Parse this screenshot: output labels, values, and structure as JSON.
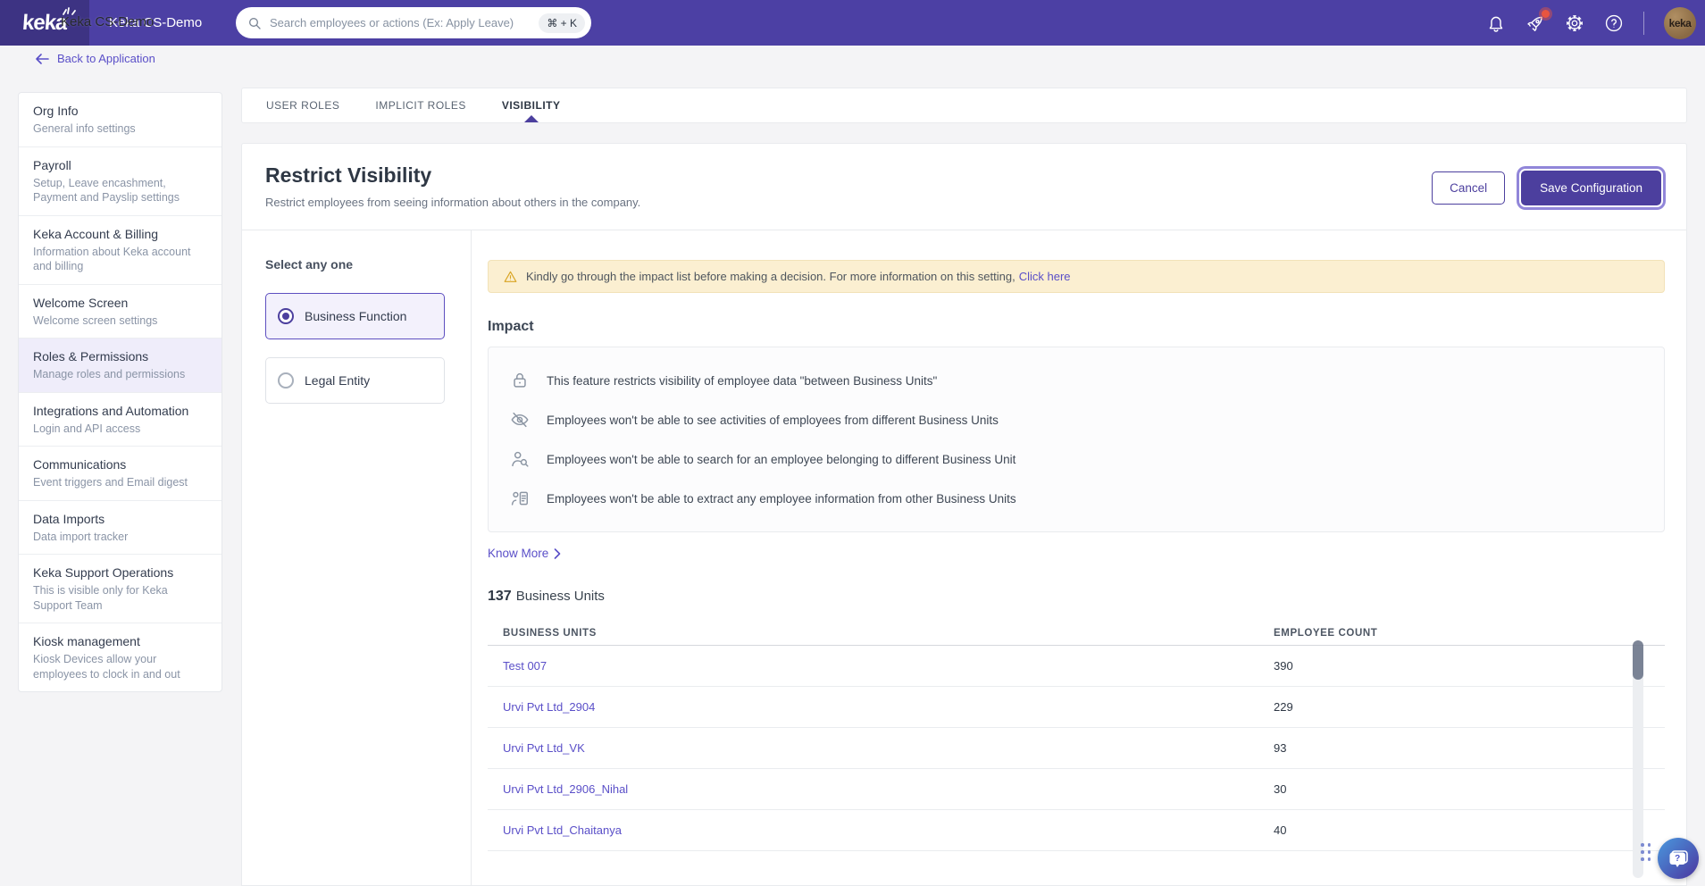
{
  "colors": {
    "navbar": "#4C40A4",
    "logo-bg": "#3D3383",
    "accent": "#4C3F9E",
    "link": "#5A4FC8",
    "page-bg": "#F4F4F6",
    "active-item": "#EFEDFA",
    "warning-bg": "#FBEFD1"
  },
  "navbar": {
    "brand": "keka",
    "company_tooltip": "Keka CS-Demo",
    "company": "Keka CS-Demo",
    "search": {
      "placeholder": "Search employees or actions (Ex: Apply Leave)",
      "shortcut": "⌘ + K"
    },
    "avatar_label": "keka"
  },
  "icons": {
    "search-icon": "magnifier",
    "bell-icon": "notification bell",
    "rocket-icon": "whats-new rocket with red badge",
    "gear-icon": "settings gear",
    "help-icon": "question mark circle",
    "back-arrow-icon": "left arrow",
    "warning-icon": "amber triangle exclamation",
    "lock-icon": "padlock",
    "eye-off-icon": "crossed eye",
    "user-search-icon": "person with magnifier",
    "user-file-icon": "person with document",
    "chevron-right-icon": "right chevron",
    "chat-bubble-icon": "help chat bubble with question mark",
    "drag-handle-icon": "six dots grid"
  },
  "sidebar": {
    "back_link": "Back to Application",
    "items": [
      {
        "title": "Org Info",
        "subtitle": "General info settings"
      },
      {
        "title": "Payroll",
        "subtitle": "Setup, Leave encashment, Payment and Payslip settings"
      },
      {
        "title": "Keka Account & Billing",
        "subtitle": "Information about Keka account and billing"
      },
      {
        "title": "Welcome Screen",
        "subtitle": "Welcome screen settings"
      },
      {
        "title": "Roles & Permissions",
        "subtitle": "Manage roles and permissions"
      },
      {
        "title": "Integrations and Automation",
        "subtitle": "Login and API access"
      },
      {
        "title": "Communications",
        "subtitle": "Event triggers and Email digest"
      },
      {
        "title": "Data Imports",
        "subtitle": "Data import tracker"
      },
      {
        "title": "Keka Support Operations",
        "subtitle": "This is visible only for Keka Support Team"
      },
      {
        "title": "Kiosk management",
        "subtitle": "Kiosk Devices allow your employees to clock in and out"
      }
    ]
  },
  "tabs": [
    {
      "label": "USER ROLES"
    },
    {
      "label": "IMPLICIT ROLES"
    },
    {
      "label": "VISIBILITY"
    }
  ],
  "header": {
    "title": "Restrict Visibility",
    "subtitle": "Restrict employees from seeing information about others in the company.",
    "cancel_label": "Cancel",
    "save_label": "Save Configuration"
  },
  "selector": {
    "label": "Select any one",
    "options": [
      {
        "label": "Business Function"
      },
      {
        "label": "Legal Entity"
      }
    ]
  },
  "banner": {
    "text": "Kindly go through the impact list before making a decision. For more information on this setting,",
    "link": "Click here"
  },
  "impact": {
    "heading": "Impact",
    "items": [
      {
        "text": "This feature restricts visibility of employee data \"between Business Units\""
      },
      {
        "text": "Employees won't be able to see activities of employees from different Business Units"
      },
      {
        "text": "Employees won't be able to search for an employee belonging to different Business Unit"
      },
      {
        "text": "Employees won't be able to extract any employee information from other Business Units"
      }
    ],
    "know_more": "Know More"
  },
  "business_units": {
    "count": "137",
    "label": "Business Units",
    "columns": [
      "BUSINESS UNITS",
      "EMPLOYEE COUNT"
    ],
    "rows": [
      {
        "name": "Test 007",
        "count": "390"
      },
      {
        "name": "Urvi Pvt Ltd_2904",
        "count": "229"
      },
      {
        "name": "Urvi Pvt Ltd_VK",
        "count": "93"
      },
      {
        "name": "Urvi Pvt Ltd_2906_Nihal",
        "count": "30"
      },
      {
        "name": "Urvi Pvt Ltd_Chaitanya",
        "count": "40"
      }
    ]
  }
}
